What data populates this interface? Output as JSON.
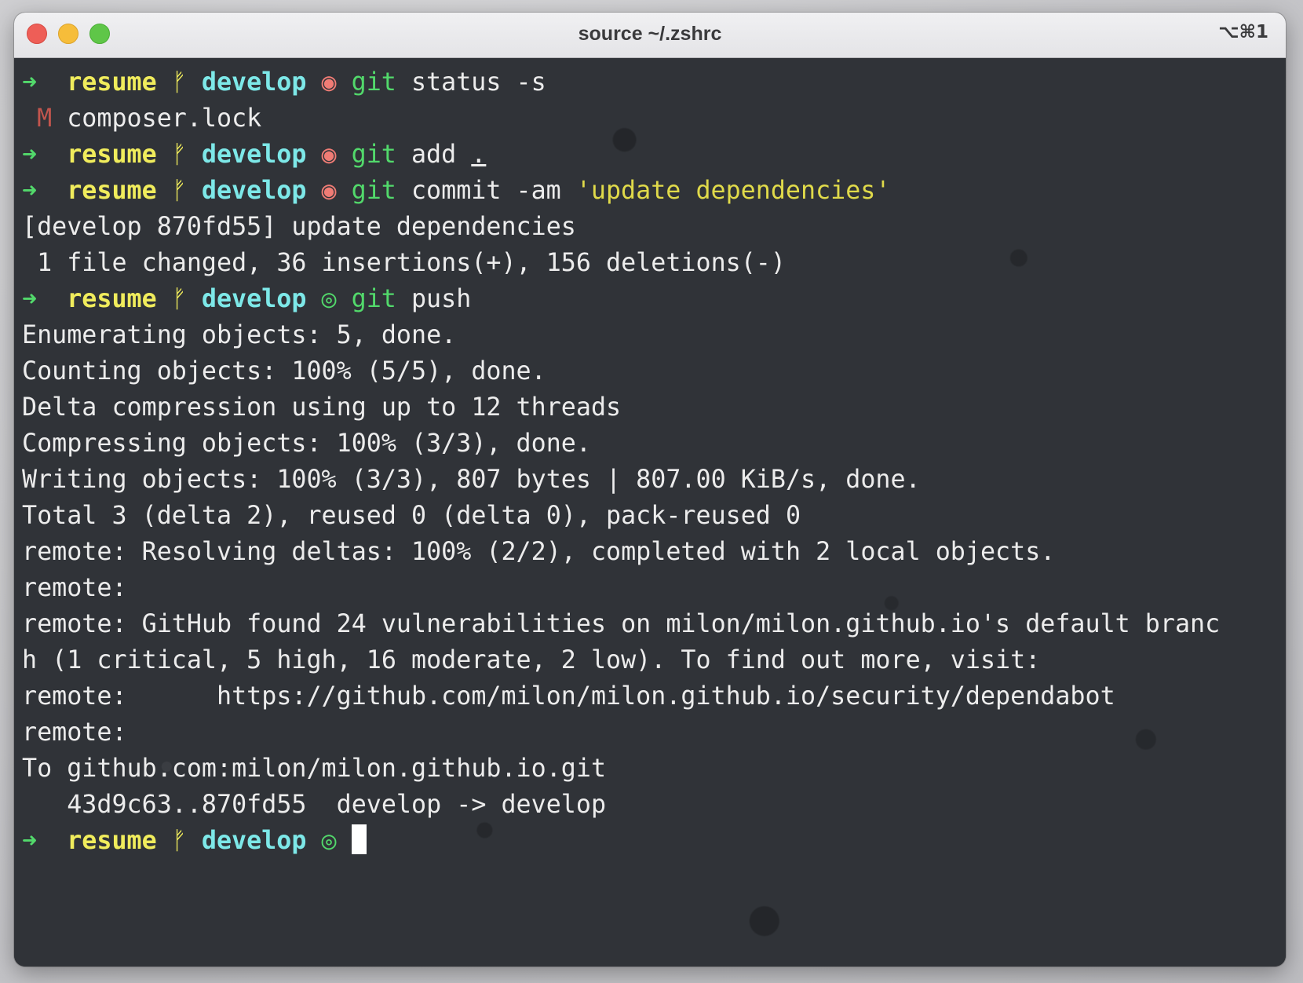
{
  "window": {
    "title": "source ~/.zshrc",
    "shortcut": "⌥⌘1"
  },
  "prompt": {
    "arrow": "➜",
    "dir": "resume",
    "branch_icon": "ᚠ",
    "branch": "develop",
    "dirty_icon": "◉",
    "clean_icon": "◎"
  },
  "colors": {
    "window_bg": "#303338",
    "titlebar_bg": "#e8e8eb",
    "arrow": "#52d96b",
    "dir": "#f0ec5c",
    "branch": "#7de8e8",
    "dirty_icon": "#f07c75",
    "string": "#e0da4a",
    "modified": "#c2554d"
  },
  "terminal": {
    "cmd1_git": "git",
    "cmd1_args": " status -s",
    "status_flag": "M",
    "status_file": " composer.lock",
    "cmd2_git": "git",
    "cmd2_args": " add ",
    "cmd2_dot": ".",
    "cmd3_git": "git",
    "cmd3_args": " commit -am ",
    "cmd3_msg": "'update dependencies'",
    "commit_result": "[develop 870fd55] update dependencies",
    "commit_stats": " 1 file changed, 36 insertions(+), 156 deletions(-)",
    "cmd4_git": "git",
    "cmd4_args": " push",
    "push_output": [
      "Enumerating objects: 5, done.",
      "Counting objects: 100% (5/5), done.",
      "Delta compression using up to 12 threads",
      "Compressing objects: 100% (3/3), done.",
      "Writing objects: 100% (3/3), 807 bytes | 807.00 KiB/s, done.",
      "Total 3 (delta 2), reused 0 (delta 0), pack-reused 0",
      "remote: Resolving deltas: 100% (2/2), completed with 2 local objects.",
      "remote:",
      "remote: GitHub found 24 vulnerabilities on milon/milon.github.io's default branc",
      "h (1 critical, 5 high, 16 moderate, 2 low). To find out more, visit:",
      "remote:      https://github.com/milon/milon.github.io/security/dependabot",
      "remote:",
      "To github.com:milon/milon.github.io.git",
      "   43d9c63..870fd55  develop -> develop"
    ]
  }
}
